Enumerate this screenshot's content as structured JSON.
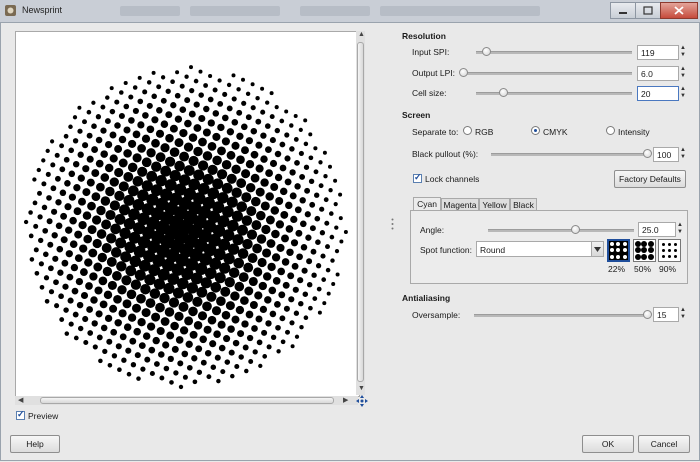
{
  "window": {
    "title": "Newsprint"
  },
  "preview": {
    "label": "Preview",
    "checked": true
  },
  "resolution": {
    "heading": "Resolution",
    "input_spi": {
      "label": "Input SPI:",
      "value": "119",
      "fraction": 0.07
    },
    "output_lpi": {
      "label": "Output LPI:",
      "value": "6.0",
      "fraction": 0.0
    },
    "cell_size": {
      "label": "Cell size:",
      "value": "20",
      "fraction": 0.18
    }
  },
  "screen": {
    "heading": "Screen",
    "separate_to_label": "Separate to:",
    "options": [
      {
        "label": "RGB",
        "selected": false
      },
      {
        "label": "CMYK",
        "selected": true
      },
      {
        "label": "Intensity",
        "selected": false
      }
    ],
    "black_pullout": {
      "label": "Black pullout (%):",
      "value": "100",
      "fraction": 1.0
    },
    "lock_channels": {
      "label": "Lock channels",
      "checked": true
    },
    "factory_defaults_label": "Factory Defaults"
  },
  "channels": {
    "tabs": [
      "Cyan",
      "Magenta",
      "Yellow",
      "Black"
    ],
    "active_tab": "Cyan",
    "angle": {
      "label": "Angle:",
      "value": "25.0",
      "fraction": 0.6
    },
    "spot_function": {
      "label": "Spot function:",
      "value": "Round"
    },
    "swatch_labels": [
      "22%",
      "50%",
      "90%"
    ]
  },
  "antialiasing": {
    "heading": "Antialiasing",
    "oversample": {
      "label": "Oversample:",
      "value": "15",
      "fraction": 1.0
    }
  },
  "buttons": {
    "help": "Help",
    "ok": "OK",
    "cancel": "Cancel"
  },
  "colors": {
    "accent": "#1f4e9b",
    "halftone": "#000000",
    "background": "#e9e9e9"
  }
}
